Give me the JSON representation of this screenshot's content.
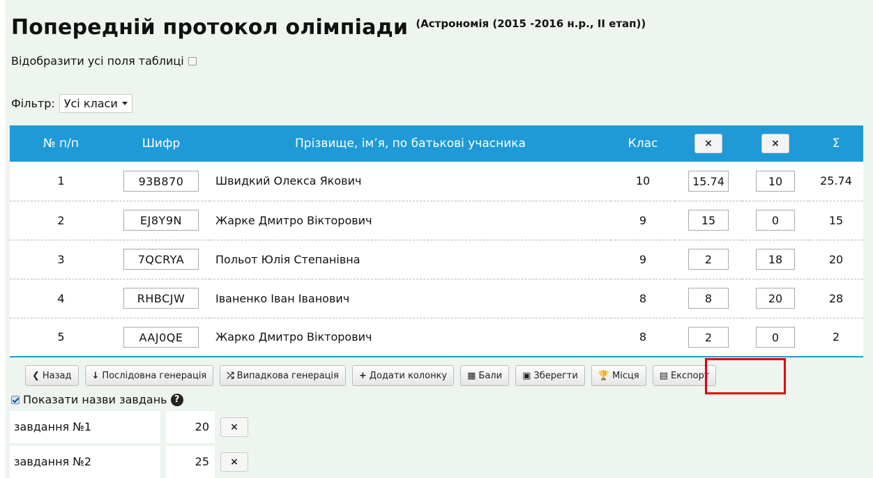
{
  "header": {
    "title": "Попередній протокол олімпіади",
    "subtitle": "(Астрономія (2015 -2016 н.р., II етап))"
  },
  "show_all_fields": {
    "label": "Відобразити усі поля таблиці",
    "checked": false
  },
  "filter": {
    "label": "Фільтр:",
    "value": "Усі класи"
  },
  "table": {
    "columns": {
      "num": "№ п/п",
      "cipher": "Шифр",
      "name": "Прізвище, ім’я, по батькові учасника",
      "grade": "Клас",
      "sum": "Σ"
    },
    "delete_icon": "×",
    "rows": [
      {
        "num": "1",
        "cipher": "93B870",
        "name": "Швидкий Олекса Якович",
        "grade": "10",
        "s1": "15.74",
        "s2": "10",
        "sum": "25.74"
      },
      {
        "num": "2",
        "cipher": "EJ8Y9N",
        "name": "Жарке Дмитро Вікторович",
        "grade": "9",
        "s1": "15",
        "s2": "0",
        "sum": "15"
      },
      {
        "num": "3",
        "cipher": "7QCRYA",
        "name": "Польот Юлія Степанівна",
        "grade": "9",
        "s1": "2",
        "s2": "18",
        "sum": "20"
      },
      {
        "num": "4",
        "cipher": "RHBCJW",
        "name": "Іваненко Іван Іванович",
        "grade": "8",
        "s1": "8",
        "s2": "20",
        "sum": "28"
      },
      {
        "num": "5",
        "cipher": "AAJ0QE",
        "name": "Жарко Дмитро Вікторович",
        "grade": "8",
        "s1": "2",
        "s2": "0",
        "sum": "2"
      }
    ]
  },
  "toolbar": {
    "back": {
      "icon": "❮",
      "label": "Назад"
    },
    "seq_gen": {
      "icon": "↓",
      "label": "Послідовна генерація"
    },
    "rand_gen": {
      "icon": "⤮",
      "label": "Випадкова генерація"
    },
    "add_col": {
      "icon": "+",
      "label": "Додати колонку"
    },
    "points": {
      "icon": "▦",
      "label": "Бали"
    },
    "save": {
      "icon": "▣",
      "label": "Зберегти"
    },
    "places": {
      "icon": "🏆",
      "label": "Місця"
    },
    "export": {
      "icon": "▤",
      "label": "Експорт"
    }
  },
  "show_task_names": {
    "label": "Показати назви завдань",
    "checked": true,
    "help": "?"
  },
  "tasks": [
    {
      "name": "завдання №1",
      "max": "20"
    },
    {
      "name": "завдання №2",
      "max": "25"
    }
  ]
}
